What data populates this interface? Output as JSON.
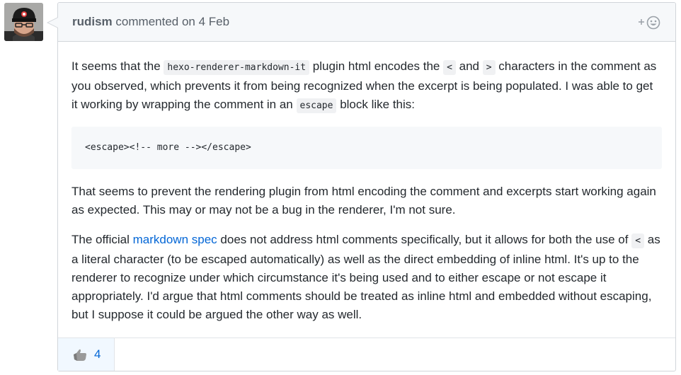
{
  "comment": {
    "author": "rudism",
    "action": "commented on",
    "date": "4 Feb",
    "para1": {
      "t1": "It seems that the ",
      "c1": "hexo-renderer-markdown-it",
      "t2": " plugin html encodes the ",
      "c2": "<",
      "t3": " and ",
      "c3": ">",
      "t4": " characters in the comment as you observed, which prevents it from being recognized when the excerpt is being populated. I was able to get it working by wrapping the comment in an ",
      "c4": "escape",
      "t5": " block like this:"
    },
    "code_block": "<escape><!-- more --></escape>",
    "para2": "That seems to prevent the rendering plugin from html encoding the comment and excerpts start working again as expected. This may or may not be a bug in the renderer, I'm not sure.",
    "para3": {
      "t1": "The official ",
      "link": "markdown spec",
      "t2": " does not address html comments specifically, but it allows for both the use of ",
      "c1": "<",
      "t3": " as a literal character (to be escaped automatically) as well as the direct embedding of inline html. It's up to the renderer to recognize under which circumstance it's being used and to either escape or not escape it appropriately. I'd argue that html comments should be treated as inline html and embedded without escaping, but I suppose it could be argued the other way as well."
    },
    "reaction": {
      "icon": "thumbs-up-icon",
      "count": "4"
    },
    "add_reaction_icon": "smiley-plus-icon"
  },
  "colors": {
    "link": "#0366d6",
    "border": "#d1d5da",
    "header_bg": "#f6f8fa",
    "reaction_bg": "#f1f8ff"
  }
}
